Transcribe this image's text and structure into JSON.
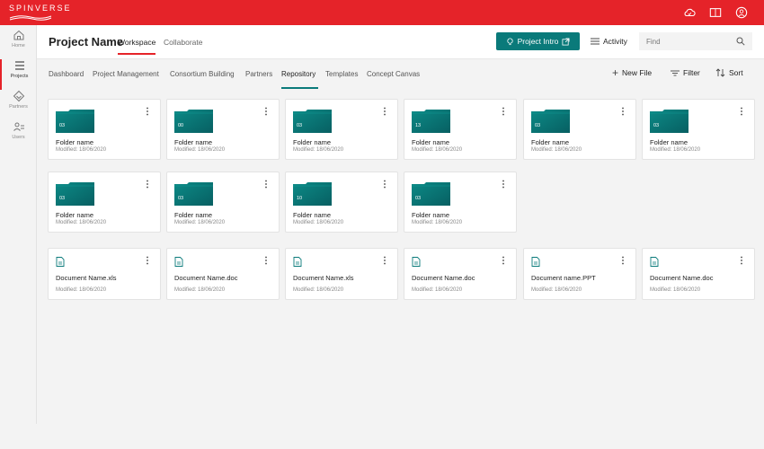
{
  "app": {
    "brand": "SPINVERSE"
  },
  "topbar": {
    "icons": [
      "cloud-icon",
      "book-icon",
      "user-icon"
    ]
  },
  "sidebar": {
    "items": [
      {
        "label": "Home",
        "icon": "home-icon"
      },
      {
        "label": "Projects",
        "icon": "list-icon",
        "active": true
      },
      {
        "label": "Partners",
        "icon": "handshake-icon"
      },
      {
        "label": "Users",
        "icon": "users-icon"
      }
    ]
  },
  "header": {
    "project_title": "Project Name",
    "tabs": [
      {
        "label": "Workspace",
        "active": true
      },
      {
        "label": "Collaborate"
      }
    ],
    "intro_button": "Project Intro",
    "activity_label": "Activity",
    "find_placeholder": "Find"
  },
  "subnav": {
    "tabs": [
      {
        "label": "Dashboard"
      },
      {
        "label": "Project Management"
      },
      {
        "label": "Consortium Building"
      },
      {
        "label": "Partners"
      },
      {
        "label": "Repository",
        "active": true
      },
      {
        "label": "Templates"
      },
      {
        "label": "Concept Canvas"
      }
    ],
    "actions": {
      "new_file": "New File",
      "filter": "Filter",
      "sort": "Sort"
    }
  },
  "colors": {
    "brand_red": "#e52329",
    "teal": "#0a7a7a"
  },
  "folders": [
    {
      "number": "03",
      "name": "Folder name",
      "modified": "Modified: 18/06/2020"
    },
    {
      "number": "00",
      "name": "Folder name",
      "modified": "Modified: 18/06/2020"
    },
    {
      "number": "03",
      "name": "Folder name",
      "modified": "Modified: 18/06/2020"
    },
    {
      "number": "13",
      "name": "Folder name",
      "modified": "Modified: 18/06/2020"
    },
    {
      "number": "03",
      "name": "Folder name",
      "modified": "Modified: 18/06/2020"
    },
    {
      "number": "03",
      "name": "Folder name",
      "modified": "Modified: 18/06/2020"
    },
    {
      "number": "03",
      "name": "Folder name",
      "modified": "Modified: 18/06/2020"
    },
    {
      "number": "03",
      "name": "Folder name",
      "modified": "Modified: 18/06/2020"
    },
    {
      "number": "10",
      "name": "Folder name",
      "modified": "Modified: 18/06/2020"
    },
    {
      "number": "03",
      "name": "Folder name",
      "modified": "Modified: 18/06/2020"
    }
  ],
  "documents": [
    {
      "name": "Document Name.xls",
      "modified": "Modified: 18/06/2020"
    },
    {
      "name": "Document Name.doc",
      "modified": "Modified: 18/06/2020"
    },
    {
      "name": "Document Name.xls",
      "modified": "Modified: 18/06/2020"
    },
    {
      "name": "Document Name.doc",
      "modified": "Modified: 18/06/2020"
    },
    {
      "name": "Document name.PPT",
      "modified": "Modified: 18/06/2020"
    },
    {
      "name": "Document Name.doc",
      "modified": "Modified: 18/06/2020"
    }
  ]
}
